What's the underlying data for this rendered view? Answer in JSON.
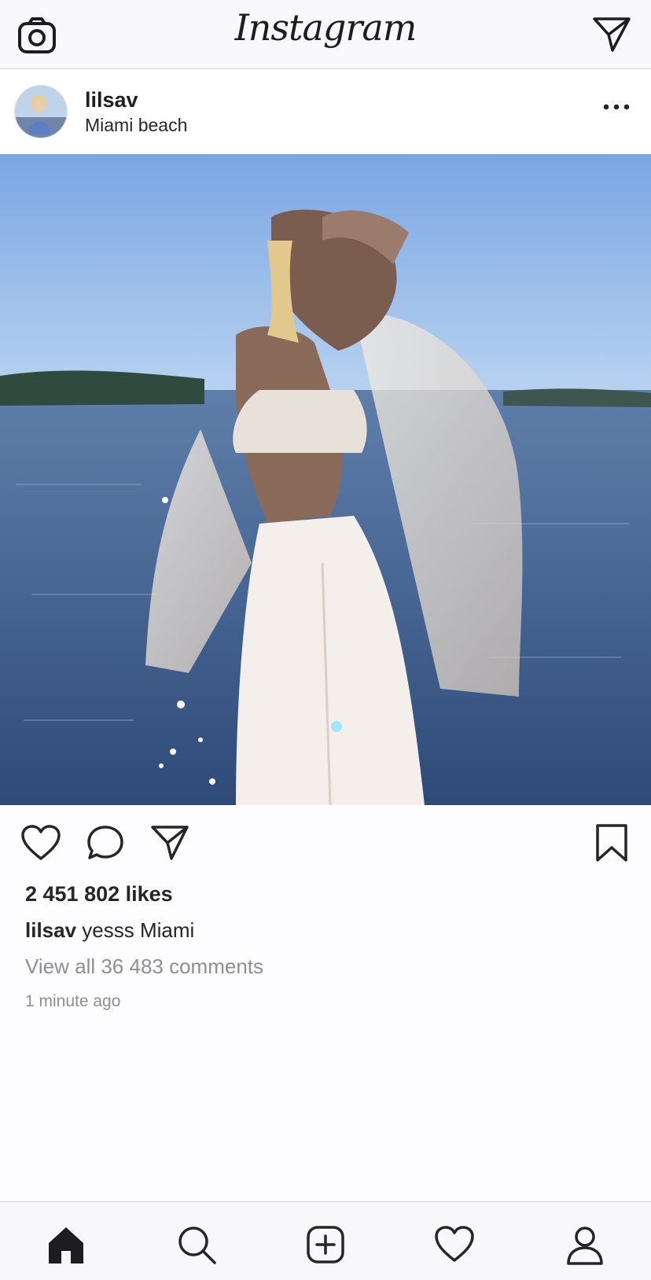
{
  "app": {
    "logo_text": "Instagram"
  },
  "topbar": {
    "camera_icon": "camera-icon",
    "dm_icon": "paper-plane-icon"
  },
  "post": {
    "username": "lilsav",
    "location": "Miami beach",
    "more_icon": "more-dots-icon",
    "likes": "2 451 802 likes",
    "caption_user": "lilsav",
    "caption_text": " yesss Miami",
    "comments_link": "View all 36 483 comments",
    "timestamp": "1 minute ago"
  },
  "actions": {
    "like_icon": "heart-icon",
    "comment_icon": "comment-bubble-icon",
    "share_icon": "paper-plane-icon",
    "save_icon": "bookmark-icon"
  },
  "bottom_nav": [
    "home-icon",
    "search-icon",
    "add-post-icon",
    "activity-heart-icon",
    "profile-icon"
  ],
  "colors": {
    "text": "#262626",
    "muted": "#8e8e93",
    "bar": "#f9f8fb",
    "sky": "#8fb8e9",
    "water": "#3f5f8f"
  }
}
